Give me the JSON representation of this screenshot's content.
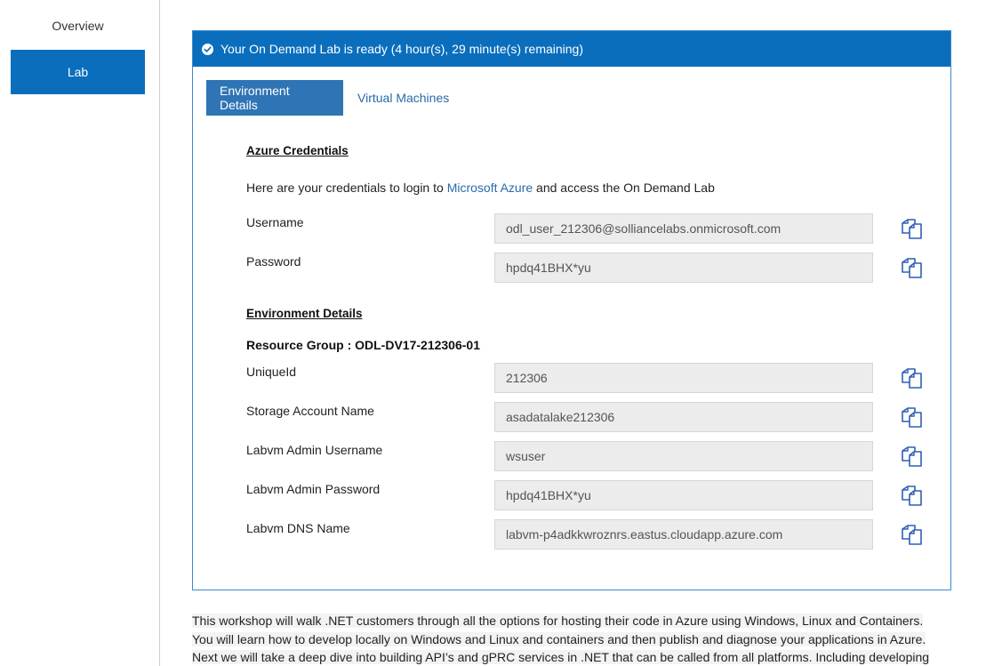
{
  "sidebar": {
    "items": [
      {
        "label": "Overview"
      },
      {
        "label": "Lab"
      }
    ]
  },
  "banner": {
    "text": "Your On Demand Lab is ready (4 hour(s), 29 minute(s) remaining)",
    "icon": "check-circle-icon"
  },
  "tabs": [
    {
      "label": "Environment Details"
    },
    {
      "label": "Virtual Machines"
    }
  ],
  "credentials": {
    "heading": "Azure Credentials",
    "intro_before": "Here are your credentials to login to ",
    "intro_link": "Microsoft Azure",
    "intro_after": " and access the On Demand Lab",
    "fields": [
      {
        "label": "Username",
        "value": "odl_user_212306@solliancelabs.onmicrosoft.com"
      },
      {
        "label": "Password",
        "value": "hpdq41BHX*yu"
      }
    ]
  },
  "environment": {
    "heading": "Environment Details",
    "resource_group": "Resource Group : ODL-DV17-212306-01",
    "fields": [
      {
        "label": "UniqueId",
        "value": "212306"
      },
      {
        "label": "Storage Account Name",
        "value": "asadatalake212306"
      },
      {
        "label": "Labvm Admin Username",
        "value": "wsuser"
      },
      {
        "label": "Labvm Admin Password",
        "value": "hpdq41BHX*yu"
      },
      {
        "label": "Labvm DNS Name",
        "value": "labvm-p4adkkwroznrs.eastus.cloudapp.azure.com"
      }
    ]
  },
  "description": {
    "line1": "This workshop will walk .NET customers through all the options for hosting their code in Azure using Windows, Linux and Containers.",
    "line2": "You will learn how to develop locally on Windows and Linux and containers and then publish and diagnose your applications in Azure.",
    "line3": "Next we will take a deep dive into building API’s and gPRC services in .NET that can be called from all platforms. Including developing"
  },
  "colors": {
    "accent": "#0a6ebd",
    "tab_active": "#2f74b5",
    "link": "#2b6aa8",
    "field_bg": "#ececec"
  }
}
